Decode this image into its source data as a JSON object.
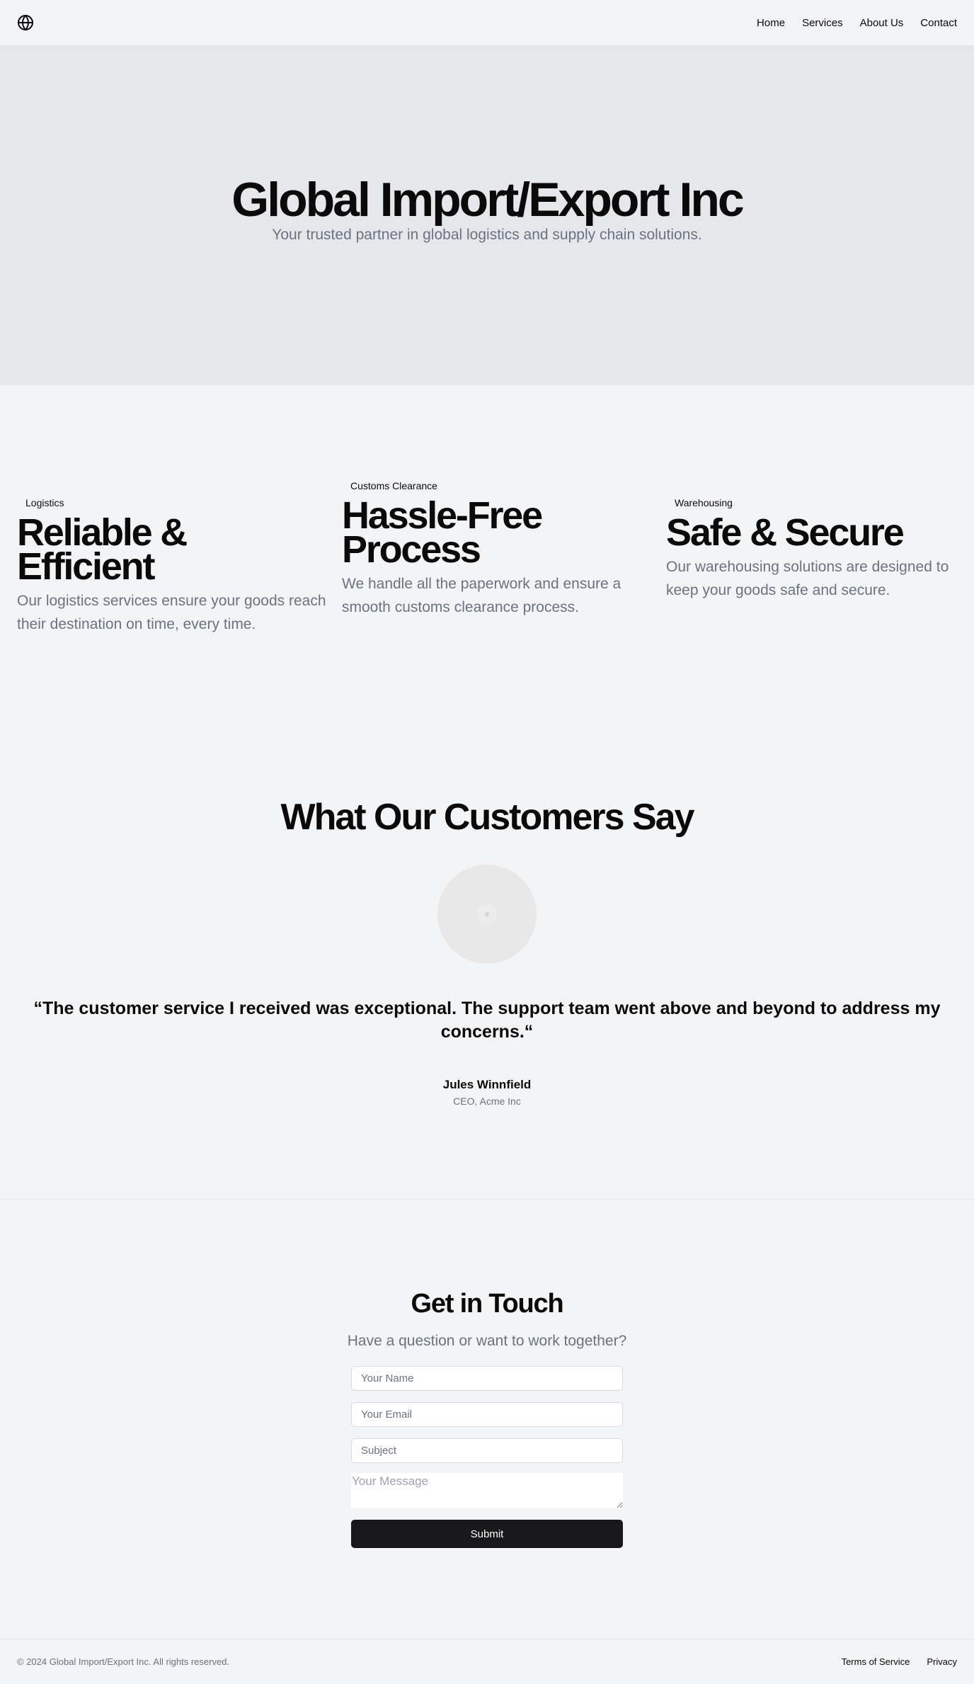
{
  "header": {
    "logo_icon": "globe-icon",
    "nav": [
      {
        "label": "Home"
      },
      {
        "label": "Services"
      },
      {
        "label": "About Us"
      },
      {
        "label": "Contact"
      }
    ]
  },
  "hero": {
    "title": "Global Import/Export Inc",
    "subtitle": "Your trusted partner in global logistics and supply chain solutions."
  },
  "services": [
    {
      "badge": "Logistics",
      "title": "Reliable & Efficient",
      "description": "Our logistics services ensure your goods reach their destination on time, every time."
    },
    {
      "badge": "Customs Clearance",
      "title": "Hassle-Free Process",
      "description": "We handle all the paperwork and ensure a smooth customs clearance process."
    },
    {
      "badge": "Warehousing",
      "title": "Safe & Secure",
      "description": "Our warehousing solutions are designed to keep your goods safe and secure."
    }
  ],
  "testimonial": {
    "heading": "What Our Customers Say",
    "quote": "“The customer service I received was exceptional. The support team went above and beyond to address my concerns.“",
    "author_name": "Jules Winnfield",
    "author_role": "CEO, Acme Inc"
  },
  "contact": {
    "heading": "Get in Touch",
    "subheading": "Have a question or want to work together?",
    "name_placeholder": "Your Name",
    "email_placeholder": "Your Email",
    "subject_placeholder": "Subject",
    "message_placeholder": "Your Message",
    "submit_label": "Submit"
  },
  "footer": {
    "copyright": "© 2024 Global Import/Export Inc. All rights reserved.",
    "links": [
      {
        "label": "Terms of Service"
      },
      {
        "label": "Privacy"
      }
    ]
  },
  "colors": {
    "background": "#f3f4f6",
    "hero_background": "#e5e7eb",
    "muted_text": "#6b7280",
    "button": "#18181b"
  }
}
